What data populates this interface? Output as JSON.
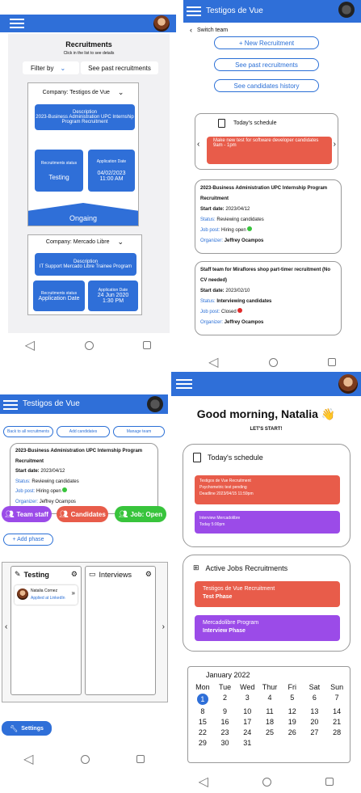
{
  "p1": {
    "title": "Recruitments",
    "hint": "Click in the list to see details",
    "filter_label": "Filter by",
    "past_btn": "See past recruitments",
    "c1": {
      "company": "Company: Testigos de Vue",
      "desc_title": "Description",
      "desc_body": "2023-Business Administration UPC Internship Program Recruitment",
      "status_label": "Recruitments status",
      "status": "Testing",
      "date_label": "Application Date",
      "date": "04/02/2023",
      "time": "11:00 AM",
      "state": "Ongaing"
    },
    "c2": {
      "company": "Company: Mercado Libre",
      "desc_title": "Description",
      "desc_body": "IT Support Mercado Libre Trainee Program",
      "status_label": "Recruitments status",
      "status": "Application Date",
      "date_label": "Application Date",
      "date": "24 Jun 2020",
      "time": "1:30 PM"
    }
  },
  "p2": {
    "team": "Testigos de Vue",
    "switch": "Switch team",
    "new_btn": "+ New Recruitment",
    "past_btn": "See past recruitments",
    "hist_btn": "See candidates history",
    "sched_title": "Today's schedule",
    "event_title": "Make new test for software developer candidates",
    "event_time": "9am - 1pm",
    "r1": {
      "title": "2023-Business Administration UPC Internship Program Recruitment",
      "start_label": "Start date:",
      "start": "2023/04/12",
      "status_label": "Status:",
      "status": "Reviewing candidates",
      "job_label": "Job post:",
      "job": "Hiring open",
      "org_label": "Organizer:",
      "org": "Jeffrey Ocampos"
    },
    "r2": {
      "title": "Staff team for Miraflores shop part-timer recruitment (No CV needed)",
      "start_label": "Start date:",
      "start": "2023/02/10",
      "status_label": "Status:",
      "status": "Interviewing candidates",
      "job_label": "Job post:",
      "job": "Closed",
      "org_label": "Organizer:",
      "org": "Jeffrey Ocampos"
    }
  },
  "p3": {
    "team": "Testigos de Vue",
    "back_btn": "Back to all recruitments",
    "add_btn": "Add candidates",
    "manage_btn": "Manage team",
    "title": "2023-Business Administration UPC Internship Program Recruitment",
    "start_label": "Start date:",
    "start": "2023/04/12",
    "status_label": "Status:",
    "status": "Reviewing candidates",
    "job_label": "Job post:",
    "job": "Hiring open",
    "org_label": "Organizer:",
    "org": "Jeffrey Ocampos",
    "staff_btn": "Team staff",
    "cand_btn": "Candidates",
    "job_btn": "Job: Open",
    "phase_btn": "+ Add phase",
    "phase1": "Testing",
    "phase2": "Interviews",
    "cand_name": "Natalia Cornez",
    "cand_note": "Applied at LinkedIn",
    "settings": "Settings"
  },
  "p4": {
    "greeting": "Good morning, Natalia",
    "wave": "👋",
    "sub": "LET'S START!",
    "sched_title": "Today's schedule",
    "e1": {
      "line1": "Testigos de Vue Recruitment",
      "line2": "Psychometric test pending",
      "line3": "Deadline 2023/04/15 11:59pm"
    },
    "e2": {
      "line1": "Interview Mercadolibre",
      "line2": "Today 5:00pm"
    },
    "jobs_title": "Active Jobs Recruitments",
    "j1": {
      "line1": "Testigos de Vue Recruitment",
      "line2": "Test Phase"
    },
    "j2": {
      "line1": "Mercadolibre Program",
      "line2": "Interview Phase"
    },
    "cal_title": "January 2022",
    "days": [
      "Mon",
      "Tue",
      "Wed",
      "Thur",
      "Fri",
      "Sat",
      "Sun"
    ],
    "dates": [
      "1",
      "2",
      "3",
      "4",
      "5",
      "6",
      "7",
      "8",
      "9",
      "10",
      "11",
      "12",
      "13",
      "14",
      "15",
      "16",
      "17",
      "18",
      "19",
      "20",
      "21",
      "22",
      "23",
      "24",
      "25",
      "26",
      "27",
      "28",
      "29",
      "30",
      "31"
    ]
  },
  "colors": {
    "brand": "#2f6fd8",
    "red": "#e85c4a",
    "purple": "#9b4be8",
    "green": "#38c43c"
  }
}
